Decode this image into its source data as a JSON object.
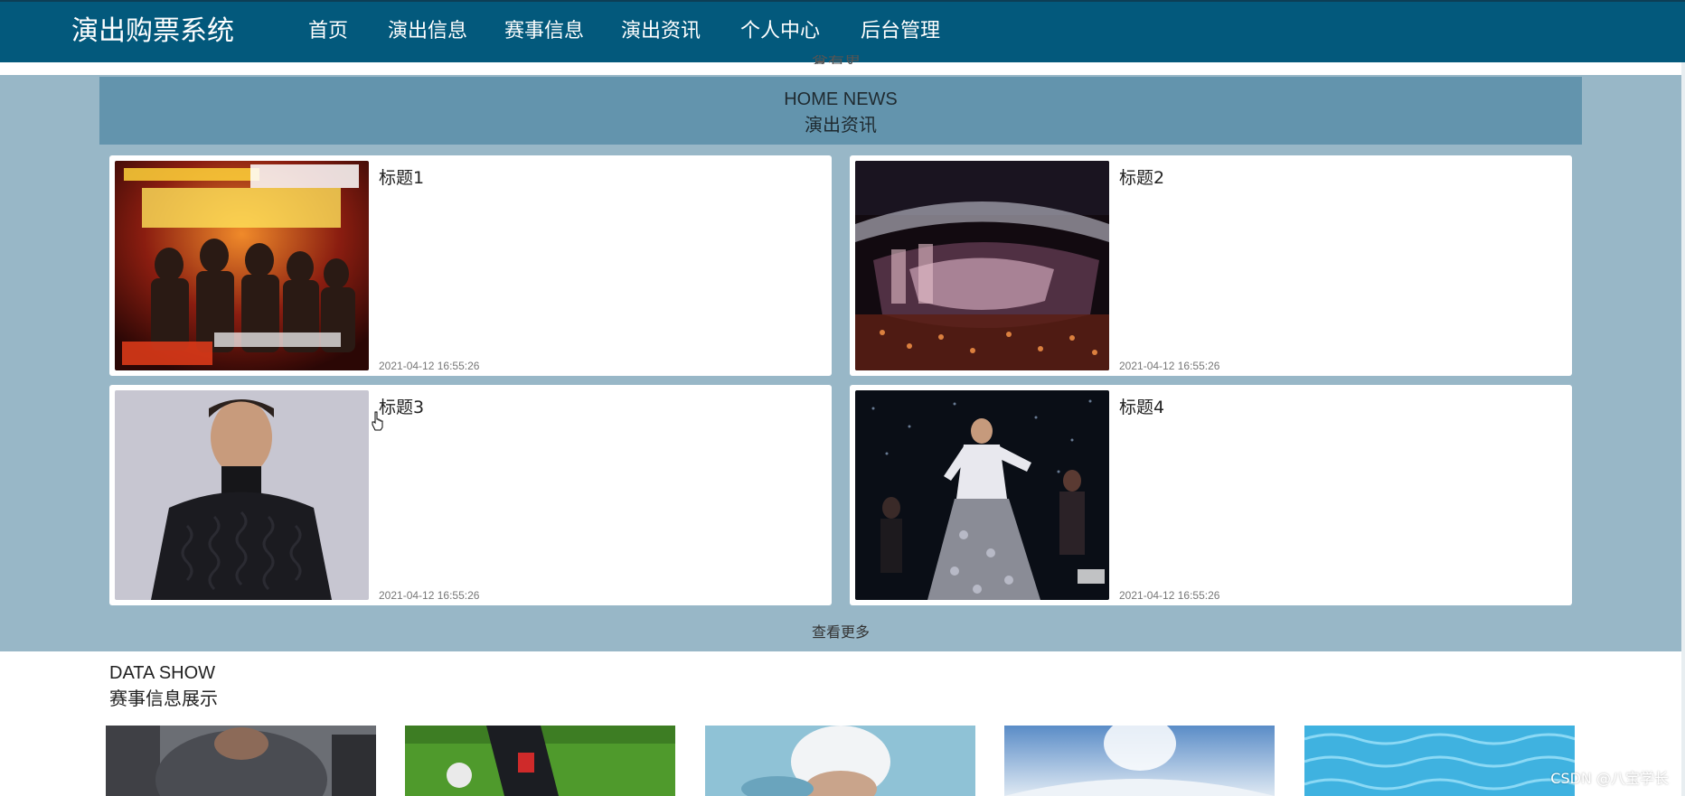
{
  "header": {
    "brand": "演出购票系统",
    "nav": [
      {
        "label": "首页",
        "active": true
      },
      {
        "label": "演出信息",
        "active": false
      },
      {
        "label": "赛事信息",
        "active": false
      },
      {
        "label": "演出资讯",
        "active": false
      },
      {
        "label": "个人中心",
        "active": false
      },
      {
        "label": "后台管理",
        "active": false
      }
    ]
  },
  "ghost_more": "查看更多",
  "news": {
    "heading_en": "HOME NEWS",
    "heading_cn": "演出资讯",
    "items": [
      {
        "title": "标题1",
        "date": "2021-04-12 16:55:26",
        "image": "mayday-noah-ark-poster"
      },
      {
        "title": "标题2",
        "date": "2021-04-12 16:55:26",
        "image": "concert-stadium-stage"
      },
      {
        "title": "标题3",
        "date": "2021-04-12 16:55:26",
        "image": "man-black-sweater-portrait"
      },
      {
        "title": "标题4",
        "date": "2021-04-12 16:55:26",
        "image": "performer-on-stage"
      }
    ],
    "view_more": "查看更多"
  },
  "data_show": {
    "heading_en": "DATA SHOW",
    "heading_cn": "赛事信息展示",
    "thumbnails": [
      "gym-athlete",
      "soccer-player",
      "swimmer-cap",
      "water-splash-sky",
      "pool-water"
    ]
  },
  "watermark": "CSDN @八宝学长",
  "colors": {
    "navbar": "#03597c",
    "news_band": "#98b7c7",
    "news_header": "#6394ad"
  }
}
